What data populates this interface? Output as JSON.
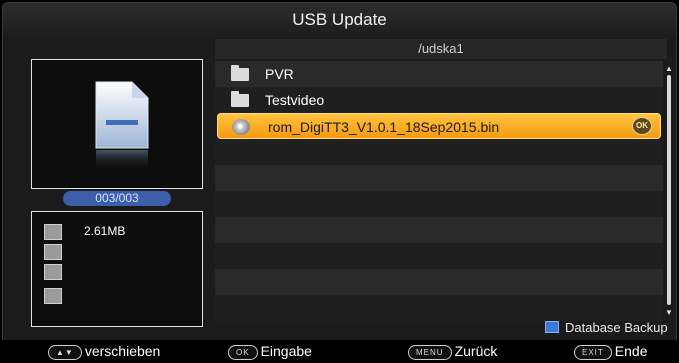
{
  "title": "USB Update",
  "path": "/udska1",
  "counter": "003/003",
  "file_info": {
    "size": "2.61MB"
  },
  "files": [
    {
      "name": "PVR",
      "type": "folder"
    },
    {
      "name": "Testvideo",
      "type": "folder"
    },
    {
      "name": "rom_DigiTT3_V1.0.1_18Sep2015.bin",
      "type": "file",
      "selected": true,
      "badge": "OK"
    }
  ],
  "db_backup": "Database Backup",
  "footer": {
    "move": {
      "key": "▲▼",
      "label": "verschieben"
    },
    "ok": {
      "key": "OK",
      "label": "Eingabe"
    },
    "menu": {
      "key": "MENU",
      "label": "Zurück"
    },
    "exit": {
      "key": "EXIT",
      "label": "Ende"
    }
  },
  "colors": {
    "selected": "#f5a623",
    "counter_bg": "#3d5fa8",
    "db_square": "#3b78d8"
  }
}
